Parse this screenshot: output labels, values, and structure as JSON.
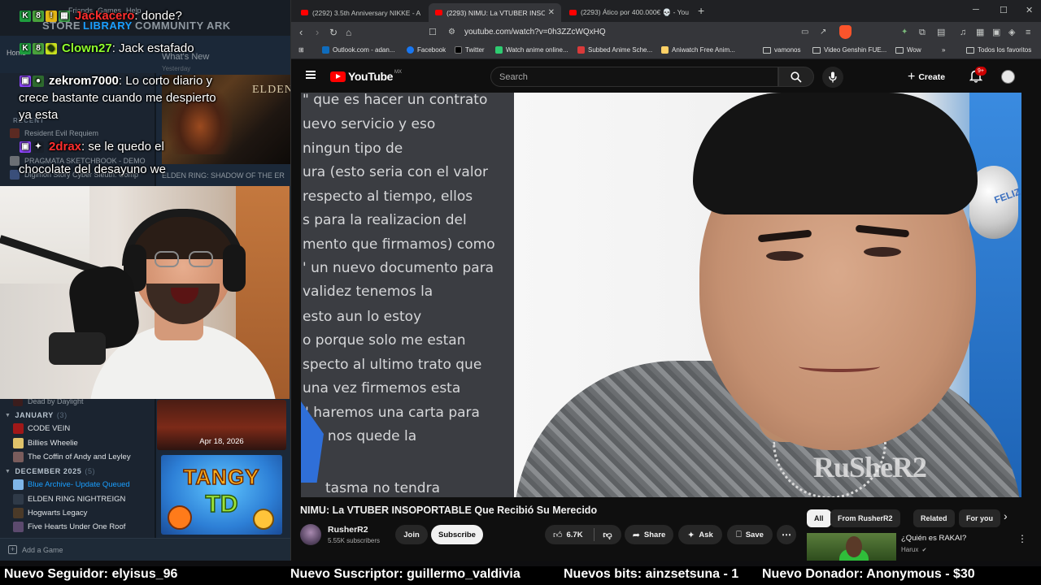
{
  "steam": {
    "nav": [
      "STORE",
      "LIBRARY",
      "COMMUNITY",
      "ARK"
    ],
    "nav_tiny": [
      "Friends",
      "Games",
      "Help"
    ],
    "home_label": "Home",
    "whats_new": "What's New",
    "whats_new_sub": "Yesterday",
    "recent_title": "RECENT",
    "recent_games": [
      "Resident Evil Requiem",
      "PRAGMATA SKETCHBOOK - DEMO",
      "Digimon Story Cyber Sleuth: Comp"
    ],
    "scrolled_item": "Dead by Daylight",
    "sections": [
      {
        "title": "JANUARY",
        "count": "(3)",
        "items": [
          "CODE VEIN",
          "Billies Wheelie",
          "The Coffin of Andy and Leyley"
        ]
      },
      {
        "title": "DECEMBER 2025",
        "count": "(5)",
        "items": [
          "Blue Archive",
          "ELDEN RING NIGHTREIGN",
          "Hogwarts Legacy",
          "Five Hearts Under One Roof"
        ]
      }
    ],
    "update_suffix": " - Update Queued",
    "add_game": "Add a Game",
    "elden_art_text": "ELDEN",
    "elden_caption": "ELDEN RING: SHADOW OF THE ER",
    "event_date": "Apr 18, 2026",
    "tangy_line1": "TANGY",
    "tangy_line2": "TD"
  },
  "chat": [
    {
      "name": "Jackacero",
      "name_color": "#ff2e2e",
      "message": ": donde?"
    },
    {
      "name": "Clown27",
      "name_color": "#8fff2e",
      "message": ": Jack estafado"
    },
    {
      "name": "zekrom7000",
      "name_color": "#ffffff",
      "message": ": Lo corto diario y",
      "cont1": "crece bastante cuando me despierto",
      "cont2": "ya esta"
    },
    {
      "name": "2drax",
      "name_color": "#ff2e2e",
      "message": ": se le quedo el",
      "cont1": "chocolate del desayuno we"
    }
  ],
  "browser": {
    "tabs": [
      {
        "title": "(2292) 3.5th Anniversary NIKKE - All"
      },
      {
        "title": "(2293) NIMU: La VTUBER INSOP"
      },
      {
        "title": "(2293) Ático por 400.000€ 💀 - YouT"
      }
    ],
    "url": "youtube.com/watch?v=0h3ZZcWQxHQ",
    "bookmarks": [
      "Outlook.com - adan...",
      "Facebook",
      "Twitter",
      "Watch anime online...",
      "Subbed Anime Sche...",
      "Aniwatch Free Anim...",
      "vamonos",
      "Video Genshin FUE...",
      "Wow",
      "Todos los favoritos"
    ]
  },
  "youtube": {
    "logo": "YouTube",
    "region": "MX",
    "search_placeholder": "Search",
    "create": "Create",
    "notifications": "9+",
    "doc_lines": [
      "\" que es hacer un contrato",
      "uevo servicio y eso",
      "ningun tipo de",
      "ura (esto seria con el valor",
      "respecto al tiempo, ellos",
      "s para la realizacion del",
      "mento que firmamos) como",
      "' un nuevo documento para",
      " validez tenemos la",
      "esto aun lo estoy",
      "o porque solo me estan",
      "specto al ultimo trato que",
      "una vez firmemos esta",
      "\" haremos una carta para",
      "olo nos quede la",
      "tasma no tendra"
    ],
    "balloon_text": "FELIZ",
    "watermark": "RuSheR2",
    "video_title": "NIMU: La VTUBER INSOPORTABLE Que Recibió Su Merecido",
    "channel_name": "RusherR2",
    "subscribers": "5.55K subscribers",
    "join": "Join",
    "subscribe": "Subscribe",
    "likes": "6.7K",
    "share": "Share",
    "ask": "Ask",
    "save": "Save",
    "chips": [
      "All",
      "From RusherR2",
      "Related",
      "For you"
    ],
    "rec_title": "¿Quién es RAKAI?",
    "rec_channel": "Harux"
  },
  "alerts": [
    "Nuevo Seguidor: elyisus_96",
    "Nuevo Suscriptor: guillermo_valdivia",
    "Nuevos bits: ainzsetsuna - 1",
    "Nuevo Donador: Anonymous - $30"
  ]
}
